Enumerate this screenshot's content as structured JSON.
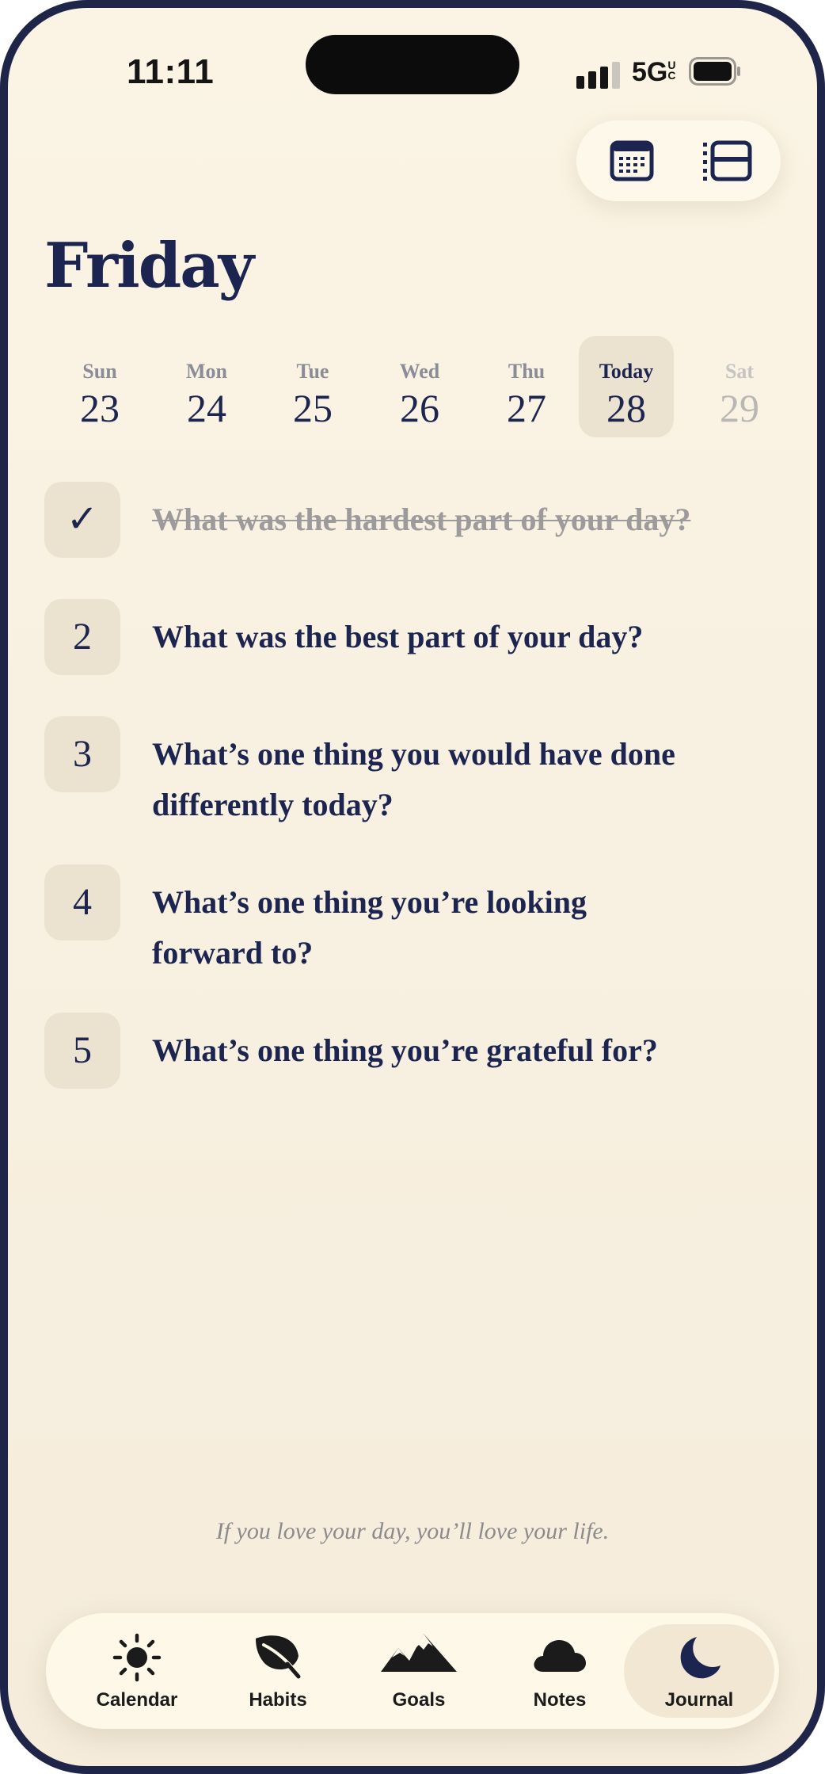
{
  "status_bar": {
    "time": "11:11",
    "network": "5G",
    "network_badge": "UC"
  },
  "header": {
    "title": "Friday",
    "view_icons": [
      "calendar-grid-icon",
      "list-view-icon"
    ]
  },
  "week": [
    {
      "name": "Sun",
      "date": "23",
      "state": "past"
    },
    {
      "name": "Mon",
      "date": "24",
      "state": "past"
    },
    {
      "name": "Tue",
      "date": "25",
      "state": "past"
    },
    {
      "name": "Wed",
      "date": "26",
      "state": "past"
    },
    {
      "name": "Thu",
      "date": "27",
      "state": "past"
    },
    {
      "name": "Today",
      "date": "28",
      "state": "today"
    },
    {
      "name": "Sat",
      "date": "29",
      "state": "future"
    }
  ],
  "questions": [
    {
      "badge": "✓",
      "text": "What was the hardest part of your day?",
      "done": true
    },
    {
      "badge": "2",
      "text": "What was the best part of your day?",
      "done": false
    },
    {
      "badge": "3",
      "text": "What’s one thing you would have done differently today?",
      "done": false
    },
    {
      "badge": "4",
      "text": "What’s one thing you’re looking forward to?",
      "done": false
    },
    {
      "badge": "5",
      "text": "What’s one thing you’re grateful for?",
      "done": false
    }
  ],
  "quote": "If you love your day, you’ll love your life.",
  "tabbar": {
    "active": "Journal",
    "items": [
      {
        "label": "Calendar",
        "icon": "sun-icon"
      },
      {
        "label": "Habits",
        "icon": "leaf-icon"
      },
      {
        "label": "Goals",
        "icon": "mountains-icon"
      },
      {
        "label": "Notes",
        "icon": "cloud-icon"
      },
      {
        "label": "Journal",
        "icon": "moon-icon"
      }
    ]
  },
  "colors": {
    "ink": "#1c2550",
    "background": "#fbf4e4",
    "badge": "#ebe2d0",
    "muted": "#9c9a9b"
  }
}
